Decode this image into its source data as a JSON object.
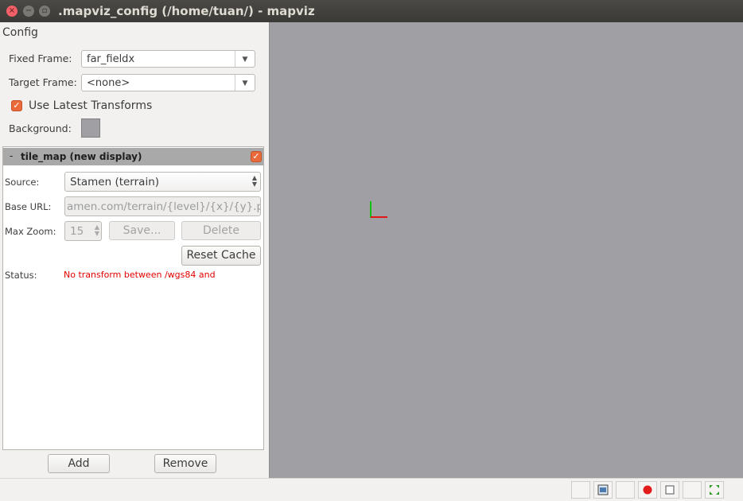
{
  "window": {
    "title": ".mapviz_config (/home/tuan/) - mapviz",
    "close_glyph": "×",
    "min_glyph": "−",
    "max_glyph": "▫"
  },
  "config": {
    "section_title": "Config",
    "fixed_frame_label": "Fixed Frame:",
    "fixed_frame_value": "far_fieldx",
    "target_frame_label": "Target Frame:",
    "target_frame_value": "<none>",
    "use_latest_label": "Use Latest Transforms",
    "use_latest_checked": true,
    "background_label": "Background:",
    "background_color": "#a0a0a4"
  },
  "display": {
    "collapse_glyph": "-",
    "name": "tile_map (new display)",
    "enabled": true,
    "source_label": "Source:",
    "source_value": "Stamen (terrain)",
    "base_url_label": "Base URL:",
    "base_url_value": "amen.com/terrain/{level}/{x}/{y}.png",
    "max_zoom_label": "Max Zoom:",
    "max_zoom_value": "15",
    "save_label": "Save...",
    "delete_label": "Delete",
    "reset_cache_label": "Reset Cache",
    "status_label": "Status:",
    "status_value": "No transform between /wgs84 and"
  },
  "actions": {
    "add_label": "Add",
    "remove_label": "Remove"
  },
  "colors": {
    "accent": "#ea6a3c",
    "map_background": "#a0a0a4",
    "status_error": "#e30000",
    "axis_x": "#e31616",
    "axis_y": "#11c211"
  }
}
